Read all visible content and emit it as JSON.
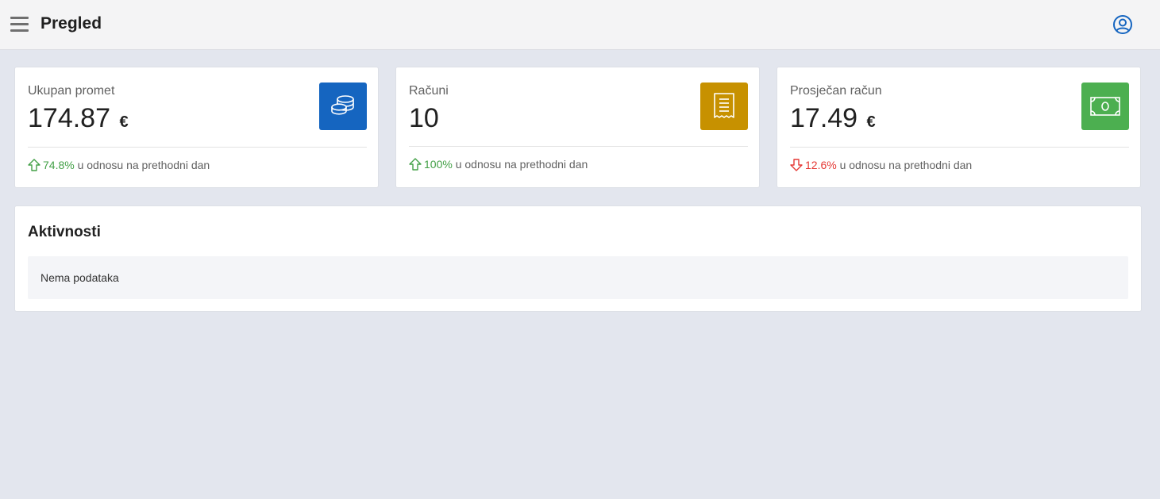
{
  "header": {
    "title": "Pregled",
    "menu_icon": "hamburger-menu-icon",
    "user_icon": "user-account-icon"
  },
  "stats": [
    {
      "label": "Ukupan promet",
      "value": "174.87",
      "unit": "€",
      "icon": "coins-stack-icon",
      "icon_color": "#1565c0",
      "change_direction": "up",
      "change": "74.8%",
      "change_text": " u odnosu na prethodni dan"
    },
    {
      "label": "Računi",
      "value": "10",
      "unit": "",
      "icon": "receipt-icon",
      "icon_color": "#c79100",
      "change_direction": "up",
      "change": "100%",
      "change_text": " u odnosu na prethodni dan"
    },
    {
      "label": "Prosječan račun",
      "value": "17.49",
      "unit": "€",
      "icon": "banknote-icon",
      "icon_color": "#4caf50",
      "change_direction": "down",
      "change": "12.6%",
      "change_text": " u odnosu na prethodni dan"
    }
  ],
  "colors": {
    "up": "#43a047",
    "down": "#e53935",
    "accent": "#1565c0"
  },
  "activity": {
    "title": "Aktivnosti",
    "empty_text": "Nema podataka"
  }
}
